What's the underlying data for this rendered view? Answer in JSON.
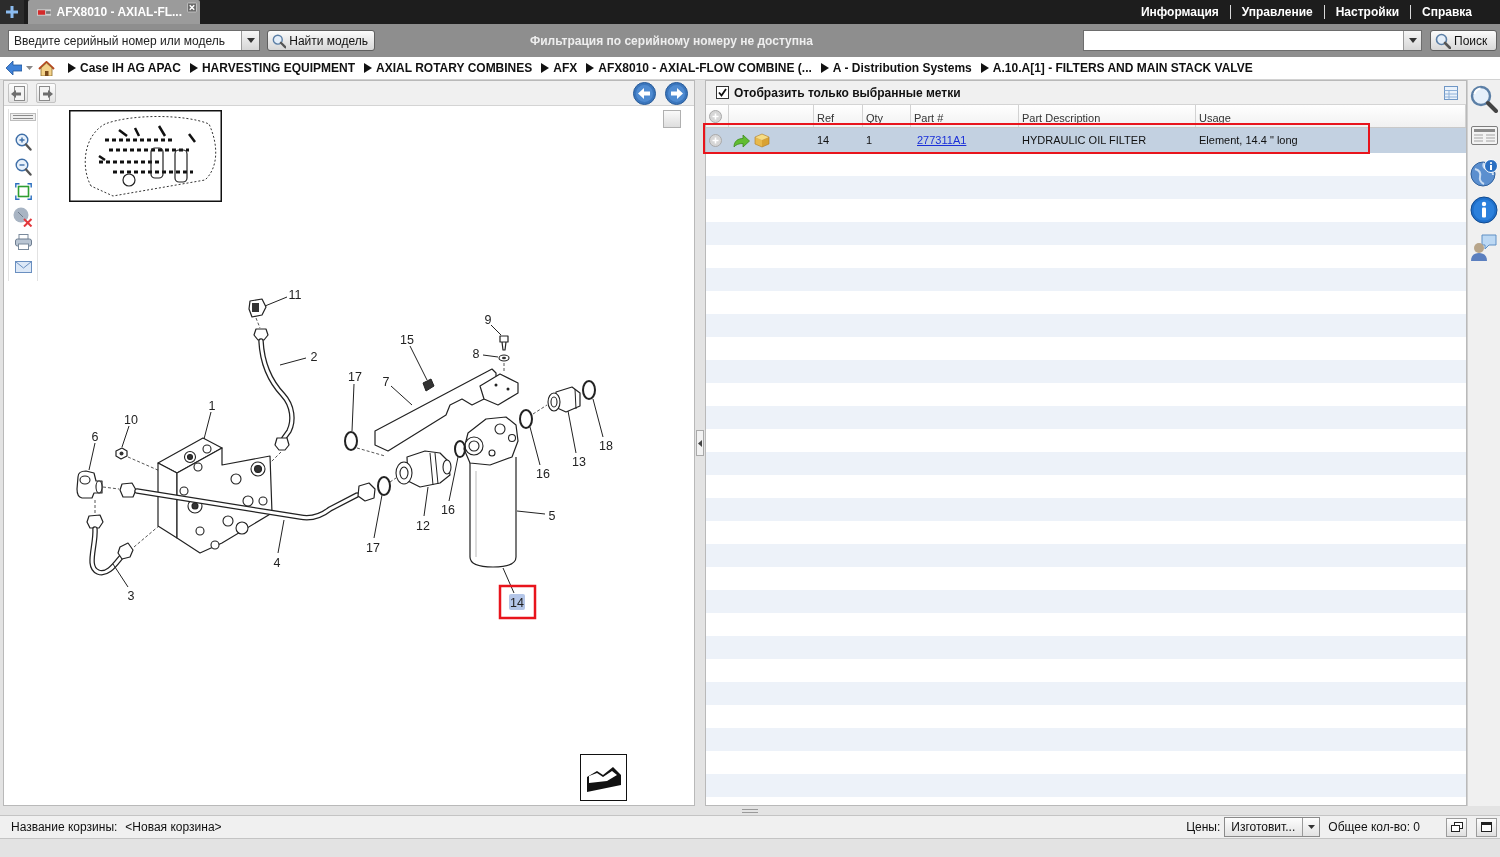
{
  "tabs": [
    {
      "label": "AFX8010 - AXIAL-FL...",
      "selected": true
    }
  ],
  "menu": [
    "Информация",
    "Управление",
    "Настройки",
    "Справка"
  ],
  "model_search": {
    "placeholder": "Введите серийный номер или модель",
    "button": "Найти модель"
  },
  "notice": "Фильтрация по серийному номеру не доступна",
  "search": {
    "button": "Поиск"
  },
  "breadcrumbs": [
    "Case IH AG APAC",
    "HARVESTING EQUIPMENT",
    "AXIAL ROTARY COMBINES",
    "AFX",
    "AFX8010 - AXIAL-FLOW COMBINE (...",
    "A - Distribution Systems",
    "A.10.A[1] - FILTERS AND MAIN STACK VALVE"
  ],
  "diagram": {
    "callouts": [
      {
        "label": "11",
        "selected": false,
        "highlighted": false
      },
      {
        "label": "9",
        "selected": false,
        "highlighted": false
      },
      {
        "label": "15",
        "selected": false,
        "highlighted": false
      },
      {
        "label": "8",
        "selected": false,
        "highlighted": false
      },
      {
        "label": "2",
        "selected": false,
        "highlighted": false
      },
      {
        "label": "17",
        "selected": false,
        "highlighted": false
      },
      {
        "label": "7",
        "selected": false,
        "highlighted": false
      },
      {
        "label": "1",
        "selected": false,
        "highlighted": false
      },
      {
        "label": "10",
        "selected": false,
        "highlighted": false
      },
      {
        "label": "6",
        "selected": false,
        "highlighted": false
      },
      {
        "label": "18",
        "selected": false,
        "highlighted": false
      },
      {
        "label": "13",
        "selected": false,
        "highlighted": false
      },
      {
        "label": "16",
        "selected": false,
        "highlighted": false
      },
      {
        "label": "16",
        "selected": false,
        "highlighted": false
      },
      {
        "label": "5",
        "selected": false,
        "highlighted": false
      },
      {
        "label": "12",
        "selected": false,
        "highlighted": false
      },
      {
        "label": "17",
        "selected": false,
        "highlighted": false
      },
      {
        "label": "4",
        "selected": false,
        "highlighted": false
      },
      {
        "label": "3",
        "selected": false,
        "highlighted": false
      },
      {
        "label": "14",
        "selected": true,
        "highlighted": true
      }
    ]
  },
  "parts_list": {
    "filter": {
      "label": "Отобразить только выбранные метки",
      "checked": true
    },
    "columns": [
      "Ref",
      "Qty",
      "Part #",
      "Part Description",
      "Usage"
    ],
    "rows": [
      {
        "ref": "14",
        "qty": "1",
        "part_number": "277311A1",
        "description": "HYDRAULIC OIL FILTER",
        "usage": "Element, 14.4 \" long",
        "selected": true,
        "highlighted": true
      }
    ]
  },
  "status_bar": {
    "cart_label": "Название корзины:",
    "cart_name": "<Новая корзина>",
    "prices_label": "Цены:",
    "prices_value": "Изготовит...",
    "total": "Общее кол-во: 0"
  }
}
